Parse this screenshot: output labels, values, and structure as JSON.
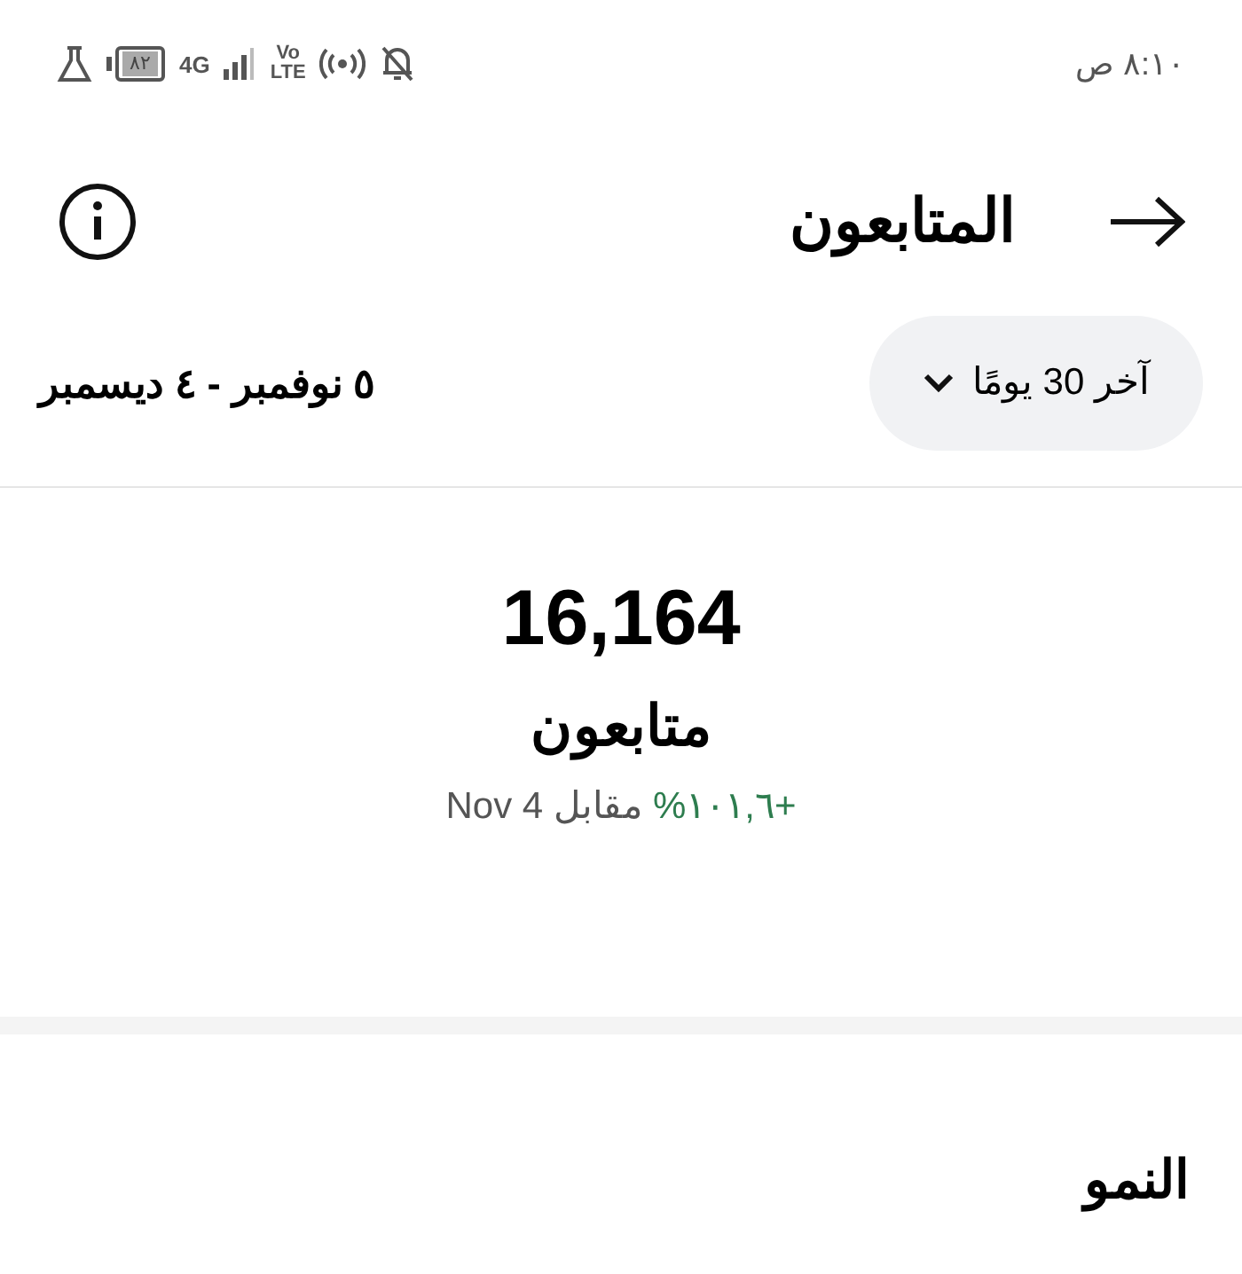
{
  "status_bar": {
    "time": "٨:١٠ ص",
    "battery": "٨٢",
    "network": "4G",
    "volte": [
      "Vo",
      "LTE"
    ]
  },
  "header": {
    "title": "المتابعون"
  },
  "filter": {
    "range": "آخر 30 يومًا",
    "dates": "٥ نوفمبر - ٤ ديسمبر"
  },
  "summary": {
    "value": "16,164",
    "label": "متابعون",
    "change": "+١٠١,٦%",
    "comparison": "مقابل Nov 4"
  },
  "section": {
    "title": "النمو"
  }
}
